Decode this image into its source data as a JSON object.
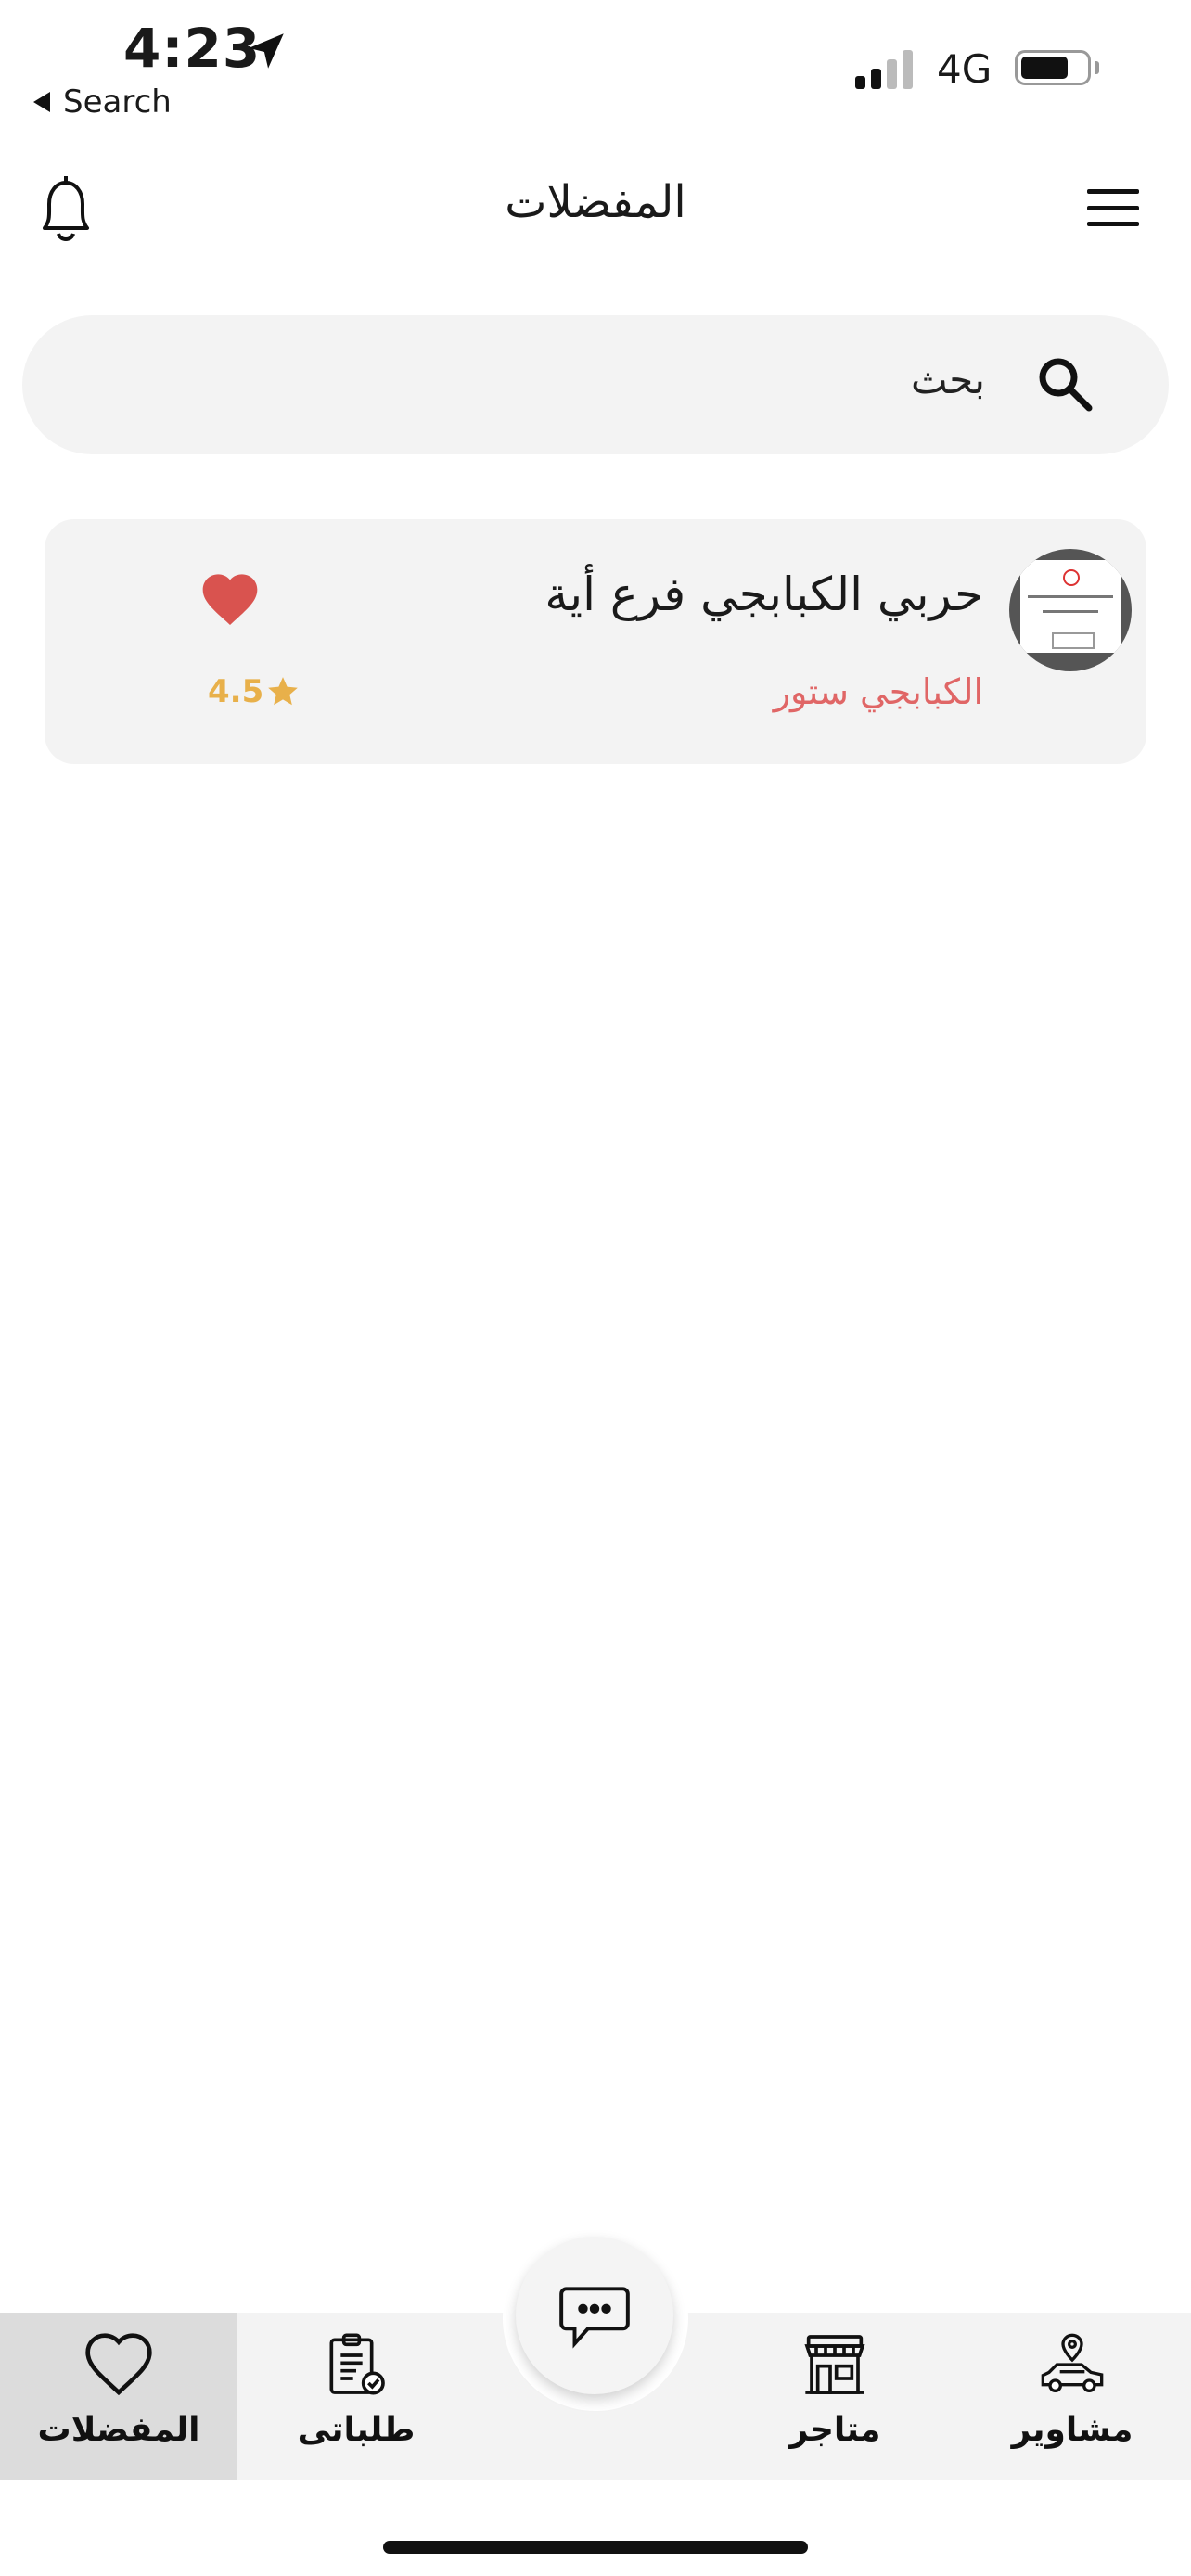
{
  "status_bar": {
    "time": "4:23",
    "back_label": "Search",
    "network": "4G"
  },
  "header": {
    "title": "المفضلات"
  },
  "search": {
    "placeholder": "بحث"
  },
  "favorites": [
    {
      "name": "حربي الكبابجي فرع أية",
      "brand": "الكبابجي ستور",
      "rating": "4.5",
      "favorited": true
    }
  ],
  "bottom_nav": {
    "items": [
      {
        "label": "المفضلات",
        "icon": "heart-outline-icon",
        "active": true
      },
      {
        "label": "طلباتى",
        "icon": "clipboard-check-icon",
        "active": false
      },
      {
        "label": "متاجر",
        "icon": "storefront-icon",
        "active": false
      },
      {
        "label": "مشاوير",
        "icon": "car-location-icon",
        "active": false
      }
    ],
    "center_button_icon": "chat-bubble-icon"
  },
  "colors": {
    "heart": "#d9534f",
    "rating": "#e8b04a",
    "brand_text": "#e06666",
    "active_tab_bg": "#dcdcdc"
  }
}
